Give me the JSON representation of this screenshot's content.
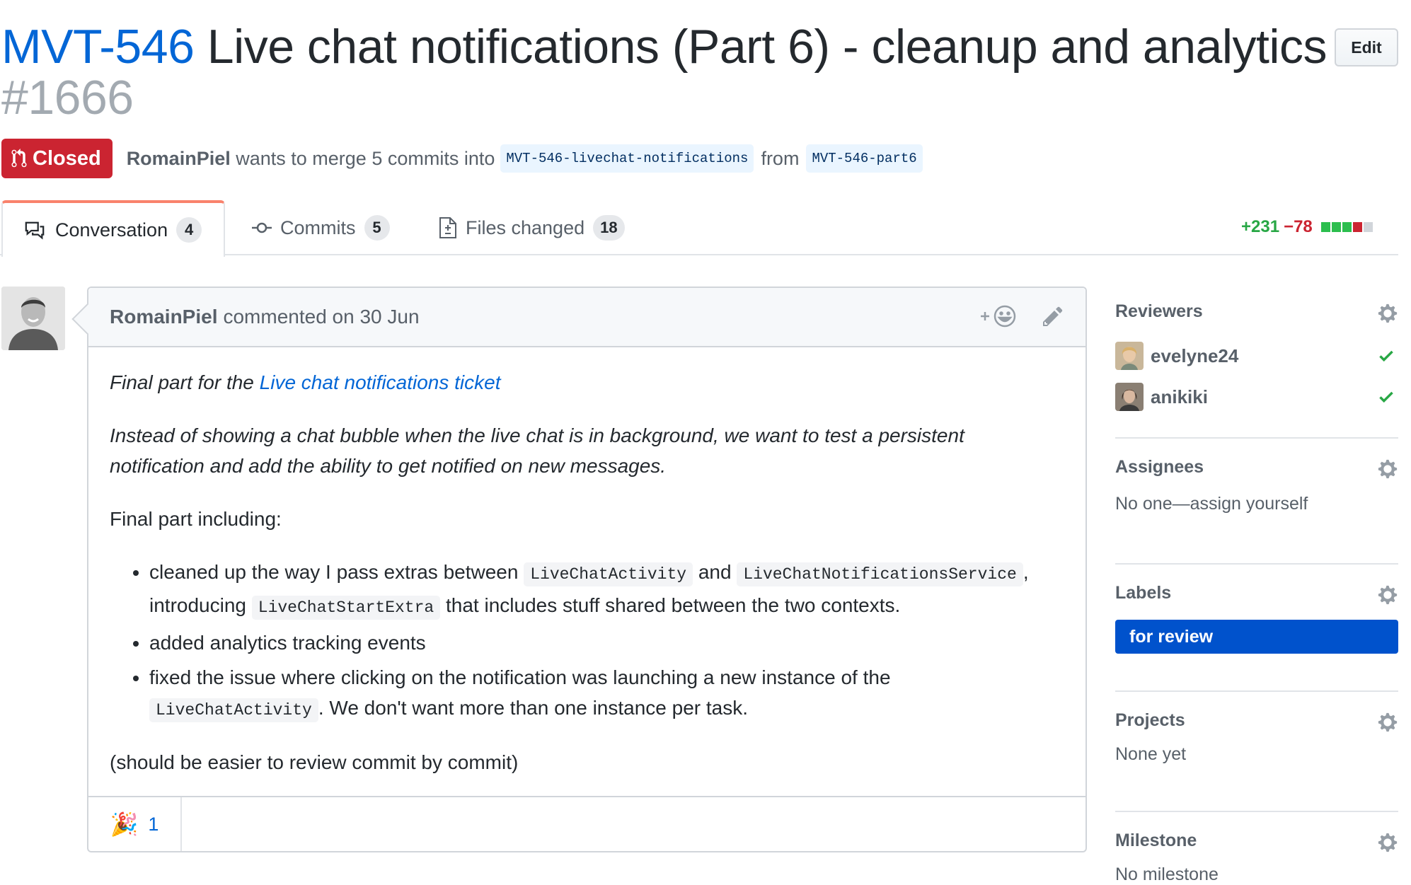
{
  "header": {
    "ticket": "MVT-546",
    "title": " Live chat notifications (Part 6) - cleanup and analytics ",
    "number": "#1666",
    "edit_label": "Edit"
  },
  "meta": {
    "state": "Closed",
    "author": "RomainPiel",
    "merge_text": " wants to merge 5 commits into ",
    "base_branch": "MVT-546-livechat-notifications",
    "from_text": "from",
    "head_branch": "MVT-546-part6"
  },
  "tabs": [
    {
      "label": "Conversation",
      "count": "4",
      "icon": "comment-discussion-icon"
    },
    {
      "label": "Commits",
      "count": "5",
      "icon": "git-commit-icon"
    },
    {
      "label": "Files changed",
      "count": "18",
      "icon": "file-diff-icon"
    }
  ],
  "diffstat": {
    "additions": "+231",
    "deletions": "−78"
  },
  "comment": {
    "author": "RomainPiel",
    "action": "commented on 30 Jun",
    "body": {
      "p1_prefix": "Final part for the ",
      "p1_link": "Live chat notifications ticket",
      "p2": "Instead of showing a chat bubble when the live chat is in background, we want to test a persistent notification and add the ability to get notified on new messages.",
      "p3": "Final part including:",
      "li1": {
        "a": "cleaned up the way I pass extras between ",
        "code1": "LiveChatActivity",
        "b": " and ",
        "code2": "LiveChatNotificationsService",
        "c": ", introducing ",
        "code3": "LiveChatStartExtra",
        "d": " that includes stuff shared between the two contexts."
      },
      "li2": "added analytics tracking events",
      "li3": {
        "a": "fixed the issue where clicking on the notification was launching a new instance of the ",
        "code1": "LiveChatActivity",
        "b": ". We don't want more than one instance per task."
      },
      "p4": "(should be easier to review commit by commit)"
    },
    "reaction": {
      "emoji": "🎉",
      "count": "1"
    }
  },
  "sidebar": {
    "reviewers": {
      "title": "Reviewers",
      "items": [
        {
          "name": "evelyne24"
        },
        {
          "name": "anikiki"
        }
      ]
    },
    "assignees": {
      "title": "Assignees",
      "text": "No one—assign yourself"
    },
    "labels": {
      "title": "Labels",
      "items": [
        {
          "name": "for review",
          "color": "#0052cc"
        }
      ]
    },
    "projects": {
      "title": "Projects",
      "text": "None yet"
    },
    "milestone": {
      "title": "Milestone",
      "text": "No milestone"
    }
  },
  "colors": {
    "closed": "#cb2431",
    "link": "#0366d6",
    "addition": "#28a745",
    "deletion": "#cb2431",
    "label": "#0052cc"
  }
}
